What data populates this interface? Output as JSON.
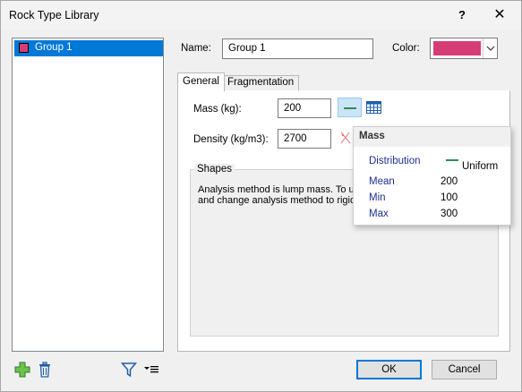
{
  "window": {
    "title": "Rock Type Library",
    "help_glyph": "?",
    "close_glyph": "✕"
  },
  "list": {
    "items": [
      {
        "label": "Group 1",
        "color": "#d63d77"
      }
    ]
  },
  "form": {
    "name_label": "Name:",
    "name_value": "Group 1",
    "color_label": "Color:",
    "color_value": "#d63d77"
  },
  "tabs": [
    {
      "label": "General"
    },
    {
      "label": "Fragmentation"
    }
  ],
  "general": {
    "mass_label": "Mass (kg):",
    "mass_value": "200",
    "density_label": "Density (kg/m3):",
    "density_value": "2700",
    "shapes_title": "Shapes",
    "shapes_text_line1": "Analysis method is lump mass. To us",
    "shapes_text_line2": "and change analysis method to rigid"
  },
  "popup": {
    "title": "Mass",
    "rows": [
      {
        "key": "Distribution",
        "value": "Uniform"
      },
      {
        "key": "Mean",
        "value": "200"
      },
      {
        "key": "Min",
        "value": "100"
      },
      {
        "key": "Max",
        "value": "300"
      }
    ]
  },
  "buttons": {
    "ok": "OK",
    "cancel": "Cancel"
  },
  "icons": {
    "add": "add-icon",
    "delete": "trash-icon",
    "filter": "filter-icon",
    "sort": "sort-icon",
    "distribution": "distribution-icon",
    "table": "table-icon",
    "random": "random-icon"
  }
}
